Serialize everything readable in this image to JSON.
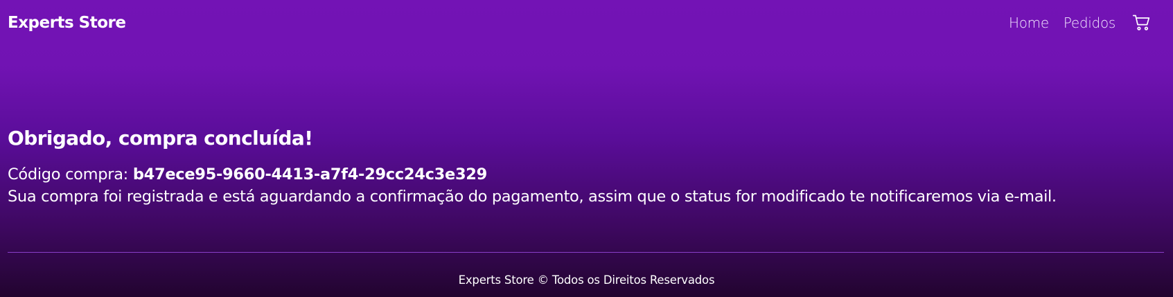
{
  "navbar": {
    "brand": "Experts Store",
    "links": [
      {
        "label": "Home"
      },
      {
        "label": "Pedidos"
      }
    ],
    "cart_icon": "cart-icon"
  },
  "main": {
    "title": "Obrigado, compra concluída!",
    "code_label": "Código compra: ",
    "code_value": "b47ece95-9660-4413-a7f4-29cc24c3e329",
    "message": "Sua compra foi registrada e está aguardando a confirmação do pagamento, assim que o status for modificado te notificaremos via e-mail."
  },
  "footer": {
    "text": "Experts Store © Todos os Direitos Reservados"
  },
  "colors": {
    "gradient_top": "#7313b5",
    "gradient_bottom": "#22042f",
    "divider": "#8a3fc9",
    "text": "#ffffff"
  }
}
